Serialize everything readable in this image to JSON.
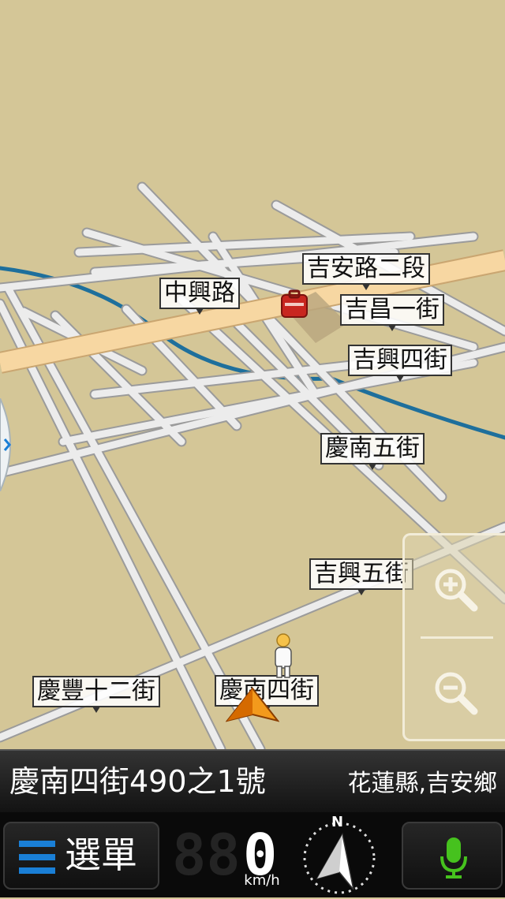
{
  "map": {
    "labels": {
      "zhongxing": "中興路",
      "jian_road": "吉安路二段",
      "jichang": "吉昌一街",
      "jixing4": "吉興四街",
      "qingnan5": "慶南五街",
      "jixing5": "吉興五街",
      "qingfeng12": "慶豐十二街",
      "qingnan4": "慶南四街"
    }
  },
  "address": {
    "main": "慶南四街490之1號",
    "region": "花蓮縣,吉安鄉"
  },
  "bottom_bar": {
    "menu_label": "選單",
    "speed_value": "0",
    "speed_unit": "km/h",
    "compass_north": "N"
  },
  "colors": {
    "land": "#d4c697",
    "road": "#ececec",
    "main_road": "#f7d7a2",
    "river": "#1e6f9c",
    "accent": "#1a7fd6",
    "mic": "#46c21e"
  }
}
